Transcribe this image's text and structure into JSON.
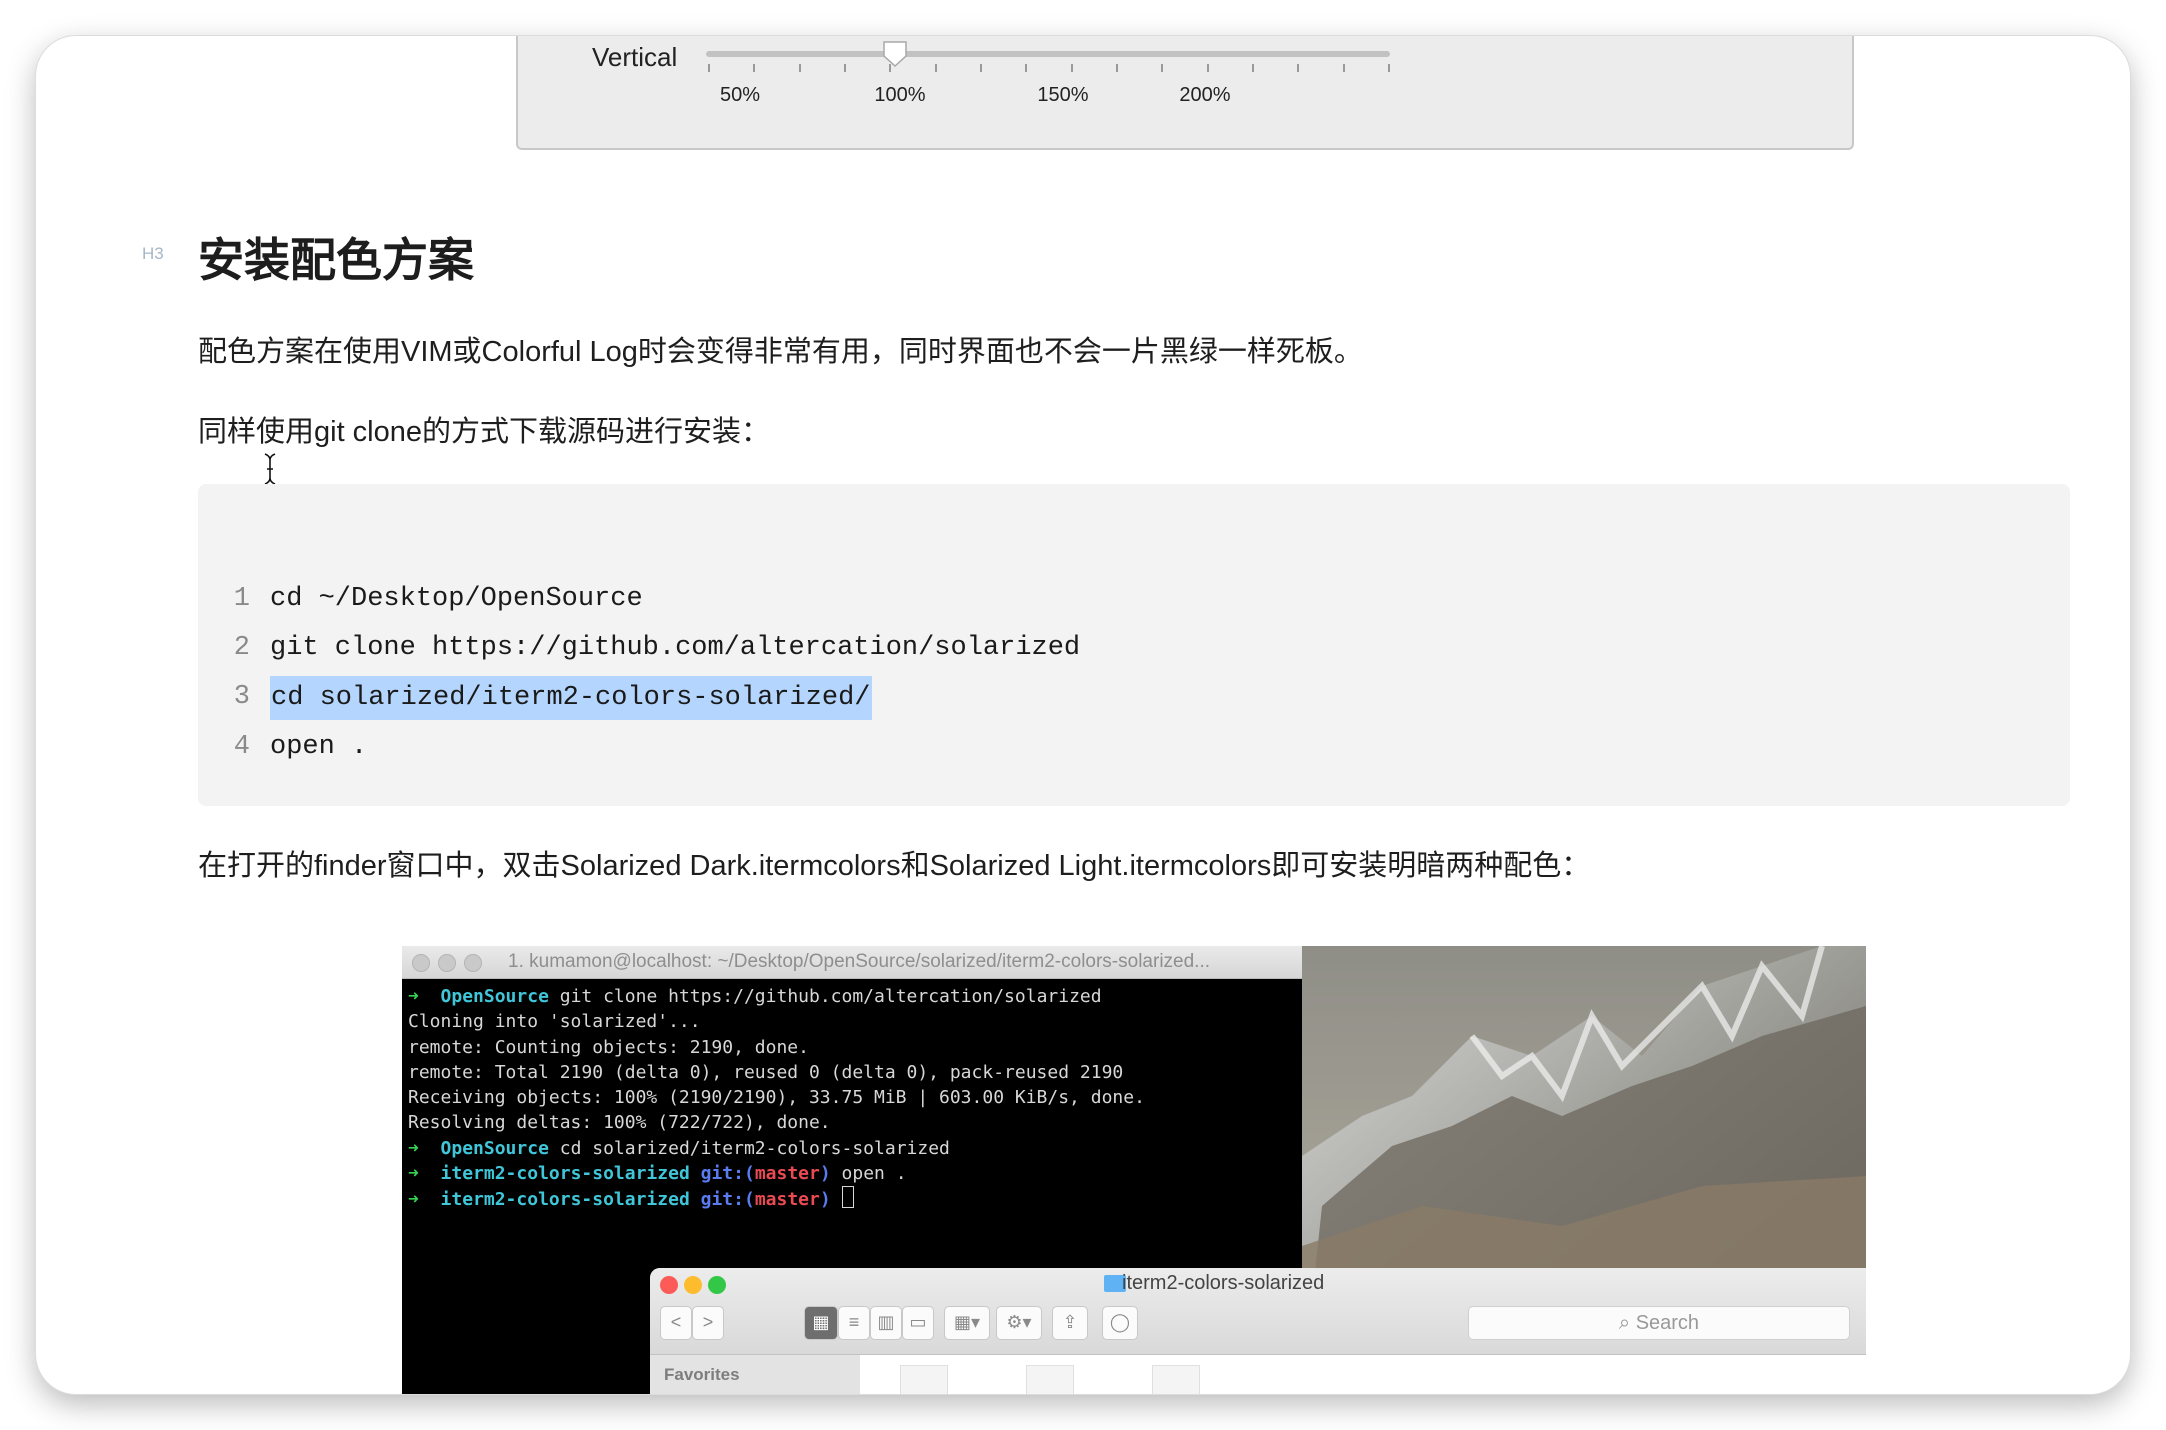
{
  "slider": {
    "label": "Vertical",
    "tick_labels": [
      "50%",
      "100%",
      "150%",
      "200%"
    ],
    "value_percent": 100
  },
  "heading": {
    "marker": "H3",
    "text": "安装配色方案"
  },
  "paragraphs": {
    "p1": "配色方案在使用VIM或Colorful Log时会变得非常有用，同时界面也不会一片黑绿一样死板。",
    "p2": "同样使用git clone的方式下载源码进行安装：",
    "p3": "在打开的finder窗口中，双击Solarized Dark.itermcolors和Solarized Light.itermcolors即可安装明暗两种配色："
  },
  "code": {
    "lines": [
      {
        "num": "1",
        "text": "cd ~/Desktop/OpenSource"
      },
      {
        "num": "2",
        "text": "git clone https://github.com/altercation/solarized"
      },
      {
        "num": "3",
        "text": "cd solarized/iterm2-colors-solarized/"
      },
      {
        "num": "4",
        "text": "open ."
      }
    ],
    "selected_line": 3,
    "selection_color": "#b4d5fe"
  },
  "screenshot": {
    "terminal_title": "1. kumamon@localhost: ~/Desktop/OpenSource/solarized/iterm2-colors-solarized...",
    "term": {
      "l1_dir": "OpenSource",
      "l1_cmd": " git clone https://github.com/altercation/solarized",
      "l2": "Cloning into 'solarized'...",
      "l3": "remote: Counting objects: 2190, done.",
      "l4": "remote: Total 2190 (delta 0), reused 0 (delta 0), pack-reused 2190",
      "l5": "Receiving objects: 100% (2190/2190), 33.75 MiB | 603.00 KiB/s, done.",
      "l6": "Resolving deltas: 100% (722/722), done.",
      "l7_dir": "OpenSource",
      "l7_cmd": " cd solarized/iterm2-colors-solarized",
      "l8_dir": "iterm2-colors-solarized",
      "l8_git": " git:(",
      "l8_branch": "master",
      "l8_close": ")",
      "l8_cmd": " open .",
      "l9_dir": "iterm2-colors-solarized",
      "l9_git": " git:(",
      "l9_branch": "master",
      "l9_close": ") ",
      "arrow": "➜"
    },
    "finder": {
      "title": "iterm2-colors-solarized",
      "search_placeholder": "Search",
      "sidebar_heading": "Favorites",
      "back": "<",
      "forward": ">"
    }
  }
}
